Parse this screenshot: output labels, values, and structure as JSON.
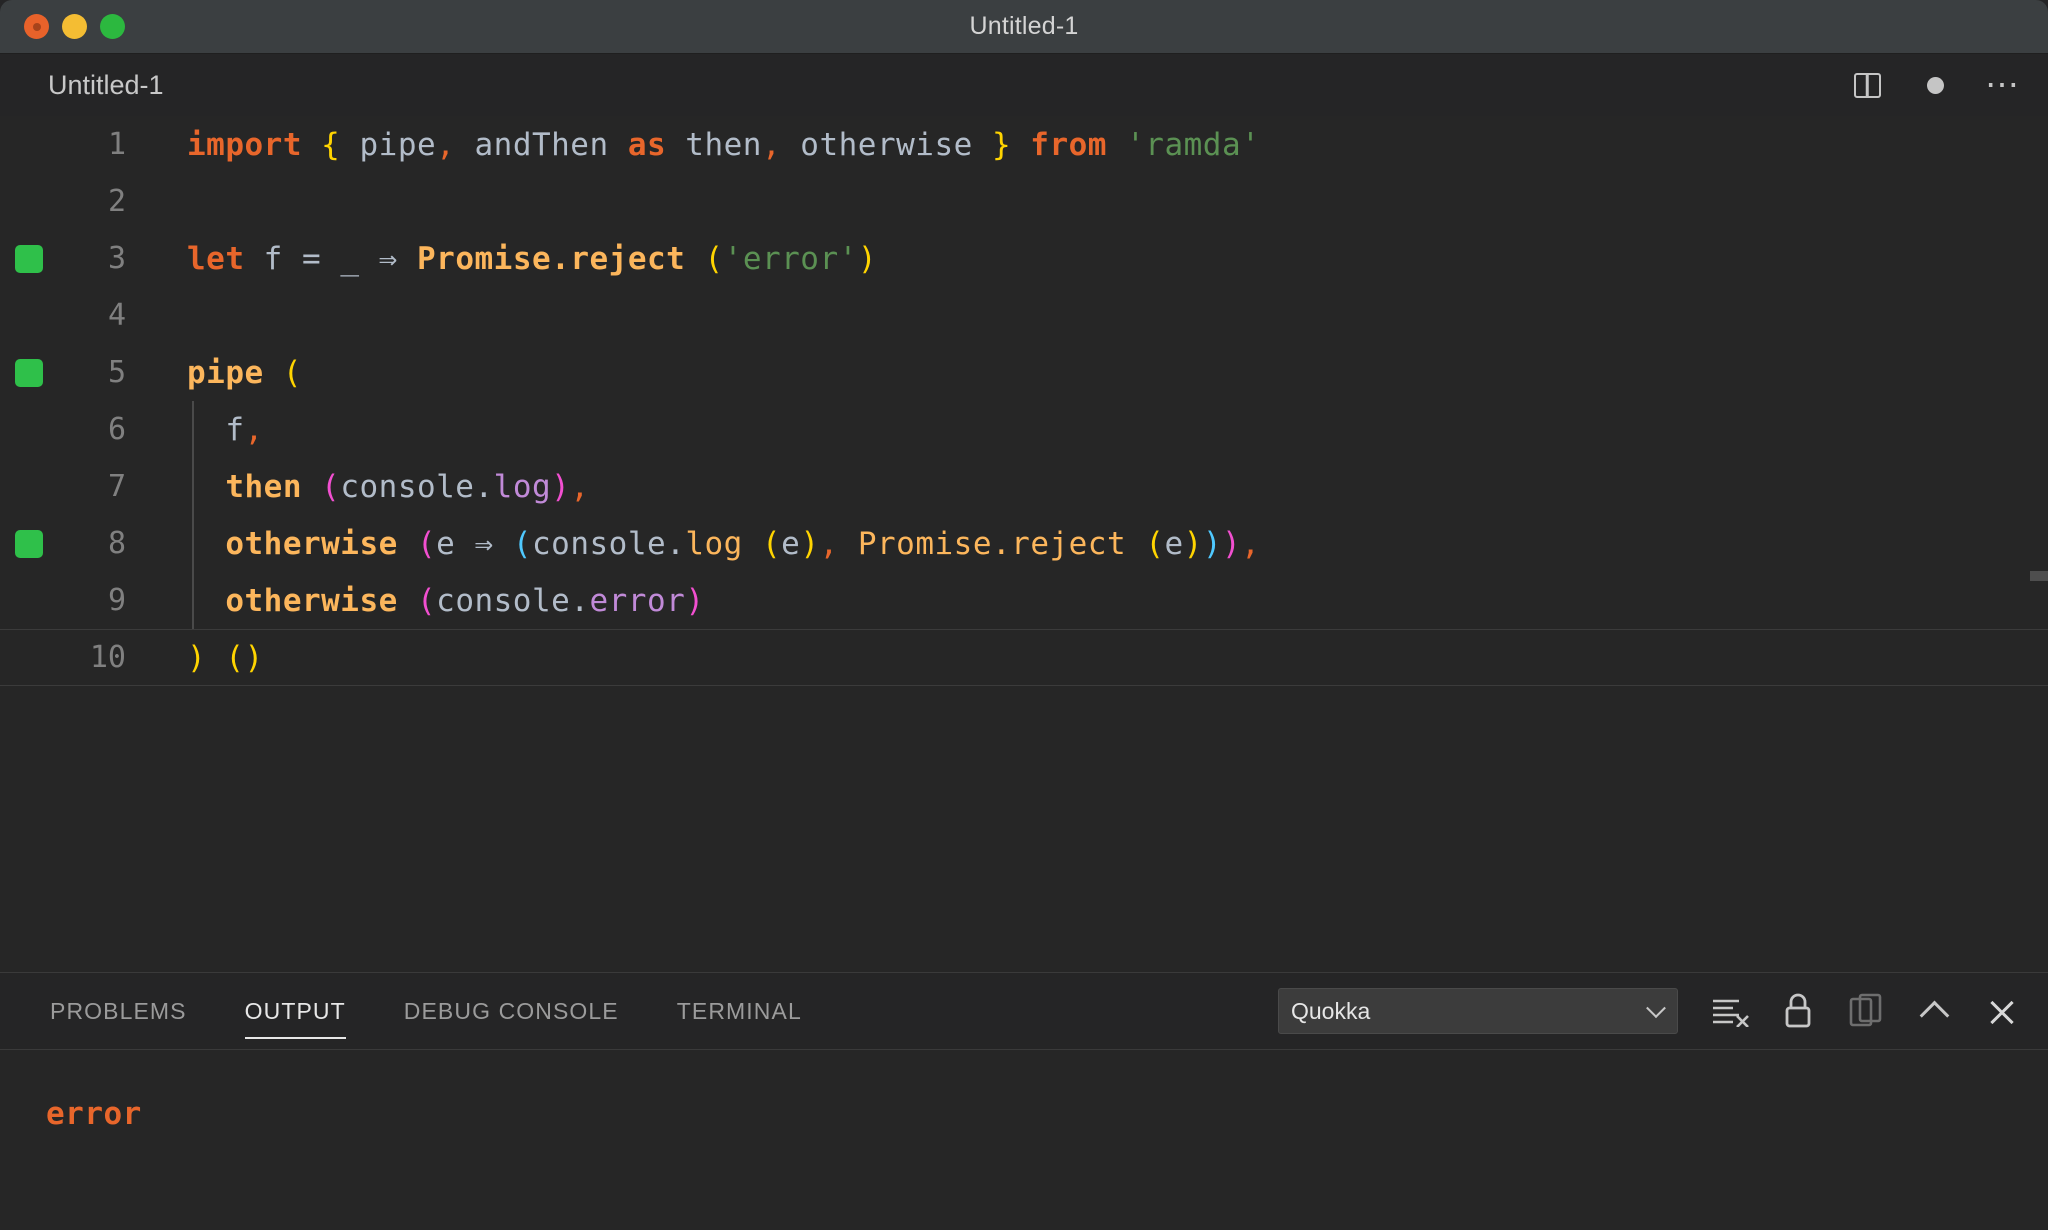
{
  "window": {
    "title": "Untitled-1",
    "traffic_lights": [
      "close-red",
      "minimize-yellow",
      "maximize-green"
    ]
  },
  "editor": {
    "tab_label": "Untitled-1",
    "actions": [
      {
        "name": "split-editor-icon",
        "label": ""
      },
      {
        "name": "unsaved-dot-icon",
        "label": ""
      },
      {
        "name": "more-actions-icon",
        "label": "⋯"
      }
    ],
    "lines": [
      {
        "number": "1",
        "breakpoint": false,
        "indent_guide": false,
        "tokens": [
          {
            "t": "import",
            "c": "t-key"
          },
          {
            "t": " ",
            "c": "t-var"
          },
          {
            "t": "{",
            "c": "t-p-yellow"
          },
          {
            "t": " pipe",
            "c": "t-var"
          },
          {
            "t": ",",
            "c": "t-punc"
          },
          {
            "t": " andThen ",
            "c": "t-var"
          },
          {
            "t": "as",
            "c": "t-key"
          },
          {
            "t": " then",
            "c": "t-var"
          },
          {
            "t": ",",
            "c": "t-punc"
          },
          {
            "t": " otherwise ",
            "c": "t-var"
          },
          {
            "t": "}",
            "c": "t-p-yellow"
          },
          {
            "t": " ",
            "c": "t-var"
          },
          {
            "t": "from",
            "c": "t-key"
          },
          {
            "t": " ",
            "c": "t-var"
          },
          {
            "t": "'ramda'",
            "c": "t-str"
          }
        ]
      },
      {
        "number": "2",
        "breakpoint": false,
        "indent_guide": false,
        "tokens": []
      },
      {
        "number": "3",
        "breakpoint": true,
        "indent_guide": false,
        "tokens": [
          {
            "t": "let",
            "c": "t-key"
          },
          {
            "t": " f ",
            "c": "t-var"
          },
          {
            "t": "=",
            "c": "t-eq"
          },
          {
            "t": " _ ",
            "c": "t-var"
          },
          {
            "t": "⇒",
            "c": "t-arrow"
          },
          {
            "t": " ",
            "c": "t-var"
          },
          {
            "t": "Promise.reject",
            "c": "t-fn"
          },
          {
            "t": " ",
            "c": "t-var"
          },
          {
            "t": "(",
            "c": "t-p-yellow"
          },
          {
            "t": "'error'",
            "c": "t-str"
          },
          {
            "t": ")",
            "c": "t-p-yellow"
          }
        ]
      },
      {
        "number": "4",
        "breakpoint": false,
        "indent_guide": false,
        "tokens": []
      },
      {
        "number": "5",
        "breakpoint": true,
        "indent_guide": false,
        "tokens": [
          {
            "t": "pipe",
            "c": "t-fn"
          },
          {
            "t": " ",
            "c": "t-var"
          },
          {
            "t": "(",
            "c": "t-p-yellow"
          }
        ]
      },
      {
        "number": "6",
        "breakpoint": false,
        "indent_guide": true,
        "tokens": [
          {
            "t": "  f",
            "c": "t-var"
          },
          {
            "t": ",",
            "c": "t-punc"
          }
        ]
      },
      {
        "number": "7",
        "breakpoint": false,
        "indent_guide": true,
        "tokens": [
          {
            "t": "  ",
            "c": "t-var"
          },
          {
            "t": "then",
            "c": "t-fn"
          },
          {
            "t": " ",
            "c": "t-var"
          },
          {
            "t": "(",
            "c": "t-p-pink"
          },
          {
            "t": "console",
            "c": "t-var"
          },
          {
            "t": ".",
            "c": "t-var"
          },
          {
            "t": "log",
            "c": "t-prop"
          },
          {
            "t": ")",
            "c": "t-p-pink"
          },
          {
            "t": ",",
            "c": "t-punc"
          }
        ]
      },
      {
        "number": "8",
        "breakpoint": true,
        "indent_guide": true,
        "tokens": [
          {
            "t": "  ",
            "c": "t-var"
          },
          {
            "t": "otherwise",
            "c": "t-fn"
          },
          {
            "t": " ",
            "c": "t-var"
          },
          {
            "t": "(",
            "c": "t-p-pink"
          },
          {
            "t": "e ",
            "c": "t-var"
          },
          {
            "t": "⇒",
            "c": "t-arrow"
          },
          {
            "t": " ",
            "c": "t-var"
          },
          {
            "t": "(",
            "c": "t-p-blue"
          },
          {
            "t": "console.",
            "c": "t-var"
          },
          {
            "t": "log",
            "c": "t-fn-plain"
          },
          {
            "t": " ",
            "c": "t-var"
          },
          {
            "t": "(",
            "c": "t-p-yellow"
          },
          {
            "t": "e",
            "c": "t-var"
          },
          {
            "t": ")",
            "c": "t-p-yellow"
          },
          {
            "t": ",",
            "c": "t-punc"
          },
          {
            "t": " ",
            "c": "t-var"
          },
          {
            "t": "Promise.reject",
            "c": "t-fn-plain"
          },
          {
            "t": " ",
            "c": "t-var"
          },
          {
            "t": "(",
            "c": "t-p-yellow"
          },
          {
            "t": "e",
            "c": "t-var"
          },
          {
            "t": ")",
            "c": "t-p-yellow"
          },
          {
            "t": ")",
            "c": "t-p-blue"
          },
          {
            "t": ")",
            "c": "t-p-pink"
          },
          {
            "t": ",",
            "c": "t-punc"
          }
        ]
      },
      {
        "number": "9",
        "breakpoint": false,
        "indent_guide": true,
        "tokens": [
          {
            "t": "  ",
            "c": "t-var"
          },
          {
            "t": "otherwise",
            "c": "t-fn"
          },
          {
            "t": " ",
            "c": "t-var"
          },
          {
            "t": "(",
            "c": "t-p-pink"
          },
          {
            "t": "console",
            "c": "t-var"
          },
          {
            "t": ".",
            "c": "t-var"
          },
          {
            "t": "error",
            "c": "t-prop"
          },
          {
            "t": ")",
            "c": "t-p-pink"
          }
        ]
      },
      {
        "number": "10",
        "breakpoint": false,
        "indent_guide": false,
        "current": true,
        "tokens": [
          {
            "t": ")",
            "c": "t-p-yellow"
          },
          {
            "t": " ",
            "c": "t-var"
          },
          {
            "t": "(",
            "c": "t-p-yellow"
          },
          {
            "t": ")",
            "c": "t-p-yellow"
          }
        ]
      }
    ]
  },
  "panel": {
    "tabs": [
      {
        "label": "PROBLEMS",
        "active": false
      },
      {
        "label": "OUTPUT",
        "active": true
      },
      {
        "label": "DEBUG CONSOLE",
        "active": false
      },
      {
        "label": "TERMINAL",
        "active": false
      }
    ],
    "channel_select": {
      "value": "Quokka",
      "options": [
        "Quokka"
      ]
    },
    "actions": [
      {
        "name": "clear-output-icon"
      },
      {
        "name": "lock-scroll-icon"
      },
      {
        "name": "open-in-editor-icon"
      },
      {
        "name": "maximize-panel-icon"
      },
      {
        "name": "close-panel-icon"
      }
    ],
    "output_lines": [
      {
        "text": "error",
        "color": "#e8662b"
      }
    ]
  },
  "colors": {
    "titlebar_bg": "#3b3f41",
    "editor_bg": "#262626",
    "panel_bg": "#252526",
    "breakpoint_green": "#2fc04a",
    "keyword_orange": "#e8662b",
    "function_yellow": "#fcb65c",
    "string_green": "#5b9153",
    "variable_grey": "#b2bcc9",
    "property_purple": "#c18ad8",
    "paren_yellow": "#ffd400",
    "paren_pink": "#f24fd0",
    "paren_blue": "#4fc9ff"
  }
}
